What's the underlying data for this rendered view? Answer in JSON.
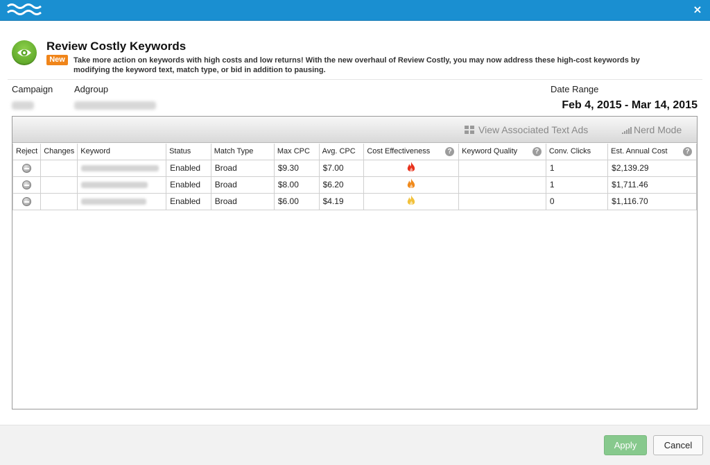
{
  "header": {
    "close_symbol": "×",
    "logo_icon": "wave-logo-icon",
    "bar_color": "#1a8fd1"
  },
  "dialog": {
    "title": "Review Costly Keywords",
    "title_icon": "eye-icon",
    "badge": "New",
    "description": "Take more action on keywords with high costs and low returns! With the new overhaul of Review Costly, you may now address these high-cost keywords by modifying the keyword text, match type, or bid in addition to pausing."
  },
  "info": {
    "campaign_label": "Campaign",
    "adgroup_label": "Adgroup",
    "date_range_label": "Date Range",
    "date_range_value": "Feb 4, 2015 - Mar 14, 2015"
  },
  "toolbar": {
    "view_ads": "View Associated Text Ads",
    "nerd_mode": "Nerd Mode"
  },
  "table": {
    "columns": [
      "Reject",
      "Changes",
      "Keyword",
      "Status",
      "Match Type",
      "Max CPC",
      "Avg. CPC",
      "Cost Effectiveness",
      "Keyword Quality",
      "Conv. Clicks",
      "Est. Annual Cost"
    ],
    "help_symbol": "?",
    "rows": [
      {
        "status": "Enabled",
        "match_type": "Broad",
        "max_cpc": "$9.30",
        "avg_cpc": "$7.00",
        "effectiveness": "flame-red",
        "conv_clicks": "1",
        "annual_cost": "$2,139.29"
      },
      {
        "status": "Enabled",
        "match_type": "Broad",
        "max_cpc": "$8.00",
        "avg_cpc": "$6.20",
        "effectiveness": "flame-orange",
        "conv_clicks": "1",
        "annual_cost": "$1,711.46"
      },
      {
        "status": "Enabled",
        "match_type": "Broad",
        "max_cpc": "$6.00",
        "avg_cpc": "$4.19",
        "effectiveness": "flame-yellow",
        "conv_clicks": "0",
        "annual_cost": "$1,116.70"
      }
    ],
    "flame_colors": {
      "flame-red": "#e8321c",
      "flame-orange": "#f08a1c",
      "flame-yellow": "#f2c13a"
    }
  },
  "footer": {
    "apply": "Apply",
    "cancel": "Cancel"
  }
}
